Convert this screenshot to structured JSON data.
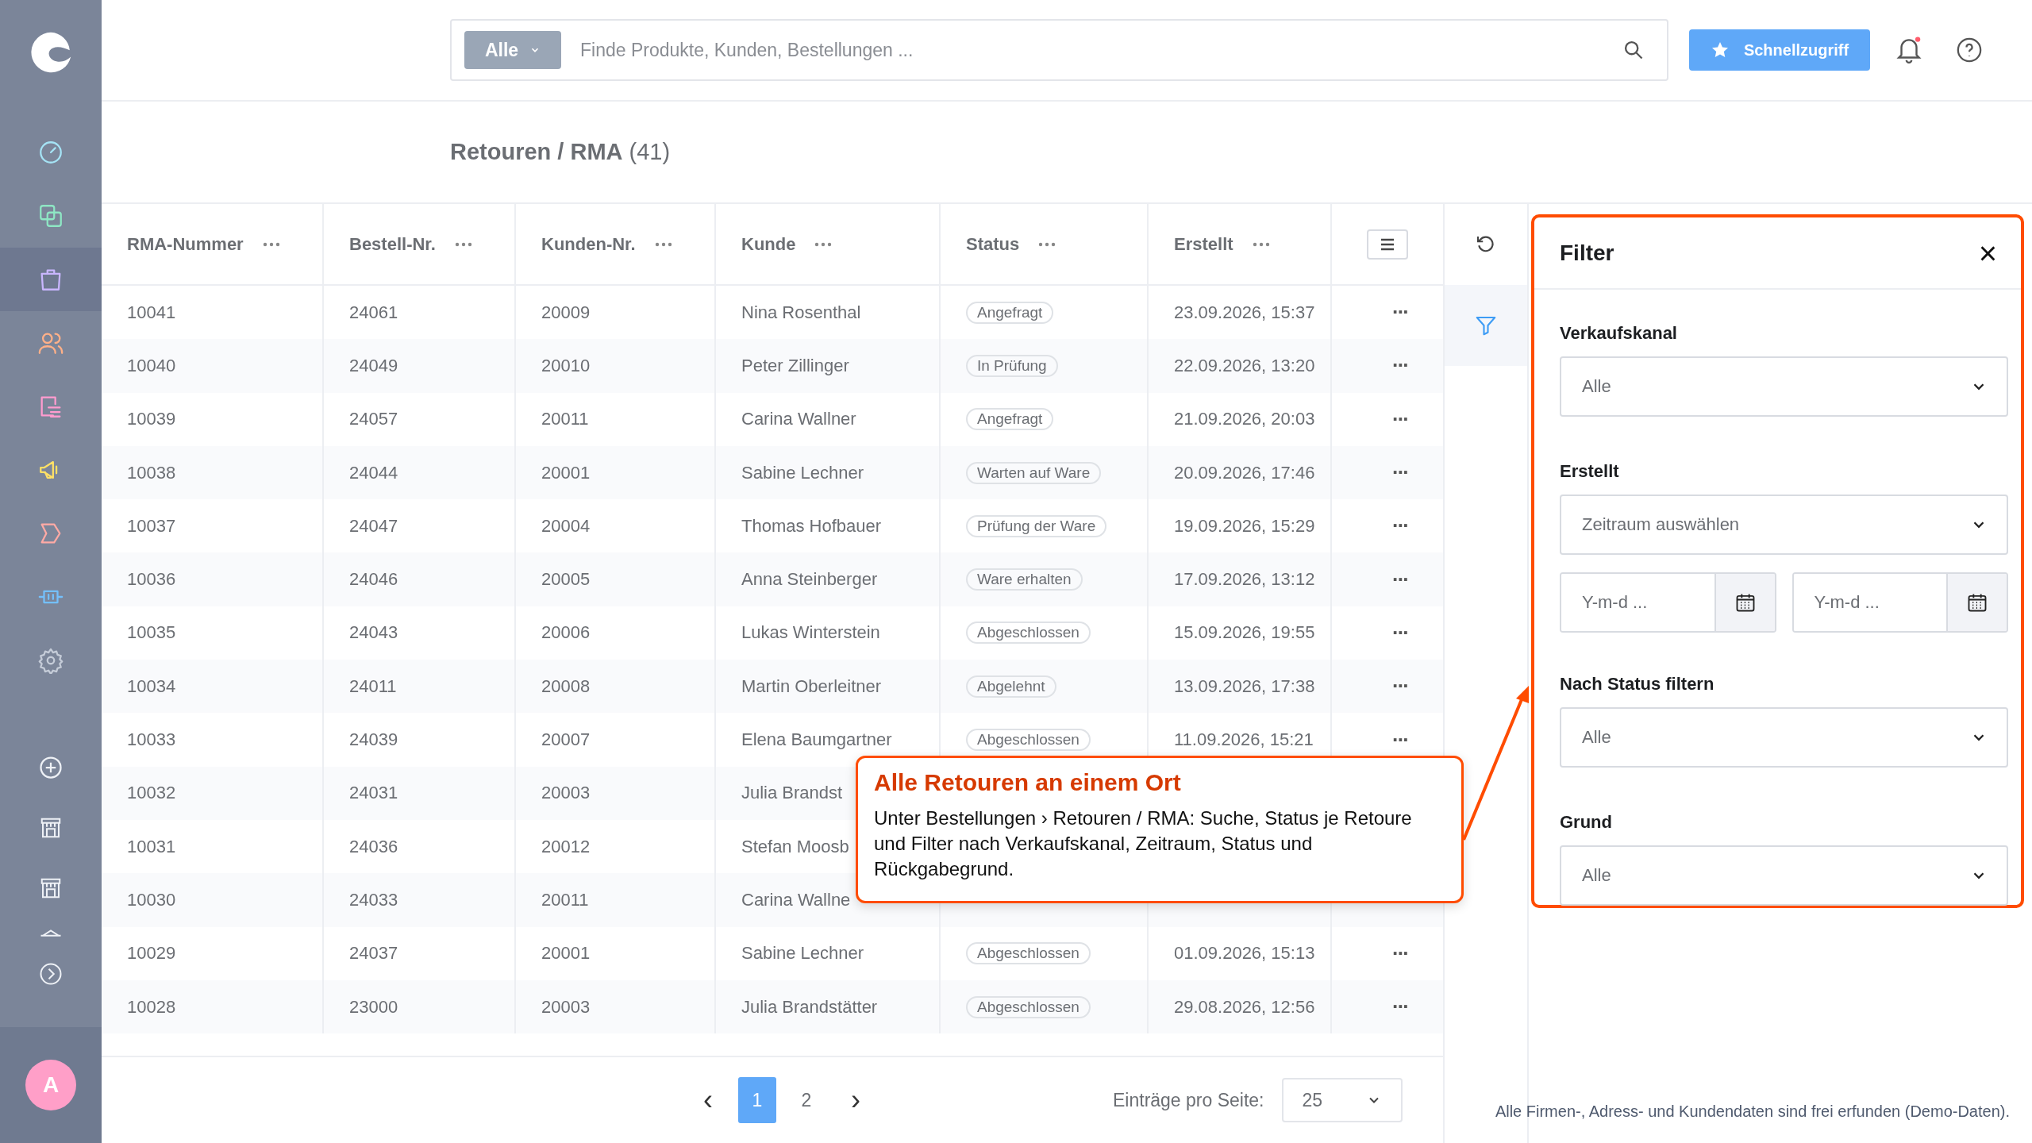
{
  "sidebar": {
    "items": [
      {
        "selected": false
      },
      {
        "selected": false
      },
      {
        "selected": true
      },
      {
        "selected": false
      },
      {
        "selected": false
      },
      {
        "selected": false
      },
      {
        "selected": false
      },
      {
        "selected": false
      },
      {
        "selected": false
      }
    ],
    "avatar": "A"
  },
  "topbar": {
    "scope": "Alle",
    "search": {
      "placeholder": "Finde Produkte, Kunden, Bestellungen ..."
    },
    "quick_access": "Schnellzugriff",
    "notification_unread": true
  },
  "page": {
    "title": "Retouren / RMA",
    "count": "(41)"
  },
  "table": {
    "columns": [
      "RMA-Nummer",
      "Bestell-Nr.",
      "Kunden-Nr.",
      "Kunde",
      "Status",
      "Erstellt"
    ],
    "rows": [
      {
        "rma": "10041",
        "order": "24061",
        "customer_no": "20009",
        "customer": "Nina Rosenthal",
        "status": "Angefragt",
        "created": "23.09.2026, 15:37",
        "actions": "···"
      },
      {
        "rma": "10040",
        "order": "24049",
        "customer_no": "20010",
        "customer": "Peter Zillinger",
        "status": "In Prüfung",
        "created": "22.09.2026, 13:20",
        "actions": "···"
      },
      {
        "rma": "10039",
        "order": "24057",
        "customer_no": "20011",
        "customer": "Carina Wallner",
        "status": "Angefragt",
        "created": "21.09.2026, 20:03",
        "actions": "···"
      },
      {
        "rma": "10038",
        "order": "24044",
        "customer_no": "20001",
        "customer": "Sabine Lechner",
        "status": "Warten auf Ware",
        "created": "20.09.2026, 17:46",
        "actions": "···"
      },
      {
        "rma": "10037",
        "order": "24047",
        "customer_no": "20004",
        "customer": "Thomas Hofbauer",
        "status": "Prüfung der Ware",
        "created": "19.09.2026, 15:29",
        "actions": "···"
      },
      {
        "rma": "10036",
        "order": "24046",
        "customer_no": "20005",
        "customer": "Anna Steinberger",
        "status": "Ware erhalten",
        "created": "17.09.2026, 13:12",
        "actions": "···"
      },
      {
        "rma": "10035",
        "order": "24043",
        "customer_no": "20006",
        "customer": "Lukas Winterstein",
        "status": "Abgeschlossen",
        "created": "15.09.2026, 19:55",
        "actions": "···"
      },
      {
        "rma": "10034",
        "order": "24011",
        "customer_no": "20008",
        "customer": "Martin Oberleitner",
        "status": "Abgelehnt",
        "created": "13.09.2026, 17:38",
        "actions": "···"
      },
      {
        "rma": "10033",
        "order": "24039",
        "customer_no": "20007",
        "customer": "Elena Baumgartner",
        "status": "Abgeschlossen",
        "created": "11.09.2026, 15:21",
        "actions": "···"
      },
      {
        "rma": "10032",
        "order": "24031",
        "customer_no": "20003",
        "customer": "Julia Brandst"
      },
      {
        "rma": "10031",
        "order": "24036",
        "customer_no": "20012",
        "customer": "Stefan Moosb"
      },
      {
        "rma": "10030",
        "order": "24033",
        "customer_no": "20011",
        "customer": "Carina Wallne"
      },
      {
        "rma": "10029",
        "order": "24037",
        "customer_no": "20001",
        "customer": "Sabine Lechner",
        "status": "Abgeschlossen",
        "created": "01.09.2026, 15:13",
        "actions": "···"
      },
      {
        "rma": "10028",
        "order": "23000",
        "customer_no": "20003",
        "customer": "Julia Brandstätter",
        "status": "Abgeschlossen",
        "created": "29.08.2026, 12:56",
        "actions": "···"
      }
    ]
  },
  "pagination": {
    "prev": "‹",
    "pages": [
      {
        "label": "1",
        "selected": true
      },
      {
        "label": "2",
        "selected": false
      }
    ],
    "next": "›",
    "per_page_label": "Einträge pro Seite:",
    "per_page": "25"
  },
  "filter": {
    "title": "Filter",
    "close": "×",
    "fields": [
      {
        "kind": "select",
        "label": "Verkaufskanal",
        "value": "Alle"
      },
      {
        "kind": "select",
        "label": "Erstellt",
        "value": "Zeitraum auswählen"
      },
      {
        "kind": "daterange",
        "from_placeholder": "Y-m-d ...",
        "to_placeholder": "Y-m-d ..."
      },
      {
        "kind": "select",
        "label": "Nach Status filtern",
        "value": "Alle"
      },
      {
        "kind": "select",
        "label": "Grund",
        "value": "Alle"
      }
    ]
  },
  "callout": {
    "title": "Alle Retouren an einem Ort",
    "text": "Unter Bestellungen › Retouren / RMA: Suche, Status je Retoure und Filter nach Verkaufskanal, Zeitraum, Status und Rückgabegrund."
  },
  "footnote": "Alle Firmen-, Adress- und Kundendaten sind frei erfunden (Demo-Daten)."
}
